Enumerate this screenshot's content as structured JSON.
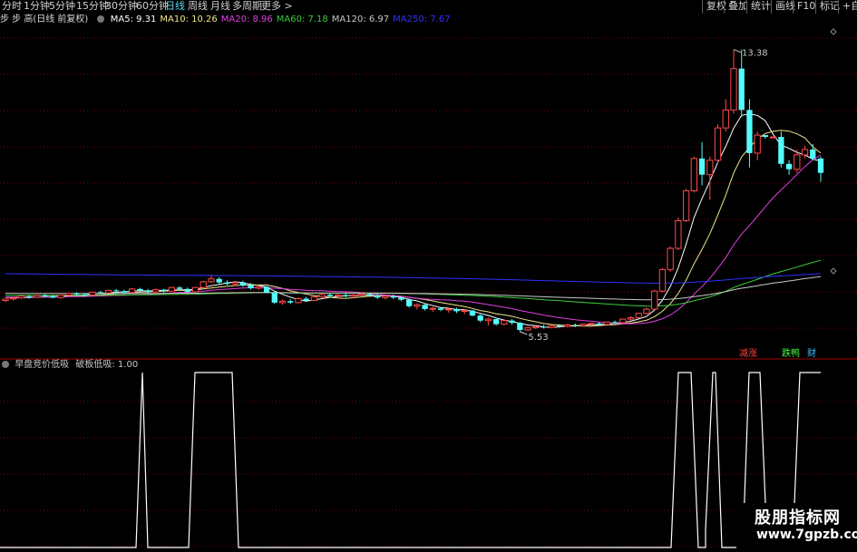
{
  "toolbar": {
    "periods": [
      "分时",
      "1分钟",
      "5分钟",
      "15分钟",
      "30分钟",
      "60分钟",
      "日线",
      "周线",
      "月线",
      "多周期",
      "更多 >"
    ],
    "active_period": "日线",
    "right_buttons": [
      "复权",
      "叠加",
      "统计",
      "画线",
      "F10",
      "标记",
      "+自选"
    ]
  },
  "main_header": {
    "title": "步 步 高(日线 前复权)",
    "ma": [
      {
        "label": "MA5: 9.31",
        "color": "#ffffff"
      },
      {
        "label": "MA10: 10.26",
        "color": "#f0e68c"
      },
      {
        "label": "MA20: 8.96",
        "color": "#e040e0"
      },
      {
        "label": "MA60: 7.18",
        "color": "#3ccd3c"
      },
      {
        "label": "MA120: 6.97",
        "color": "#c8c8c8"
      },
      {
        "label": "MA250: 7.67",
        "color": "#3030ff"
      }
    ]
  },
  "annotations": {
    "high": "13.38",
    "low": "5.53"
  },
  "signal_labels": [
    {
      "text": "减涨",
      "color": "#ff4040"
    },
    {
      "text": "跌鸭",
      "color": "#40ff40"
    },
    {
      "text": "财",
      "color": "#40c0ff"
    }
  ],
  "sub_header": {
    "title": "早盘竞价低吸",
    "indicator": "破板低吸: 1.00"
  },
  "watermark": {
    "title": "股朋指标网",
    "url": "www.7gpzb.com"
  },
  "colors": {
    "up": "#ff4a4a",
    "down": "#54fcfc",
    "bg": "#000000",
    "grid": "#7a0000"
  },
  "chart_data": {
    "type": "candlestick",
    "price_range": [
      5.53,
      13.38
    ],
    "candles": [
      [
        6.4,
        6.45,
        6.35,
        6.44
      ],
      [
        6.44,
        6.5,
        6.4,
        6.47
      ],
      [
        6.47,
        6.55,
        6.44,
        6.52
      ],
      [
        6.52,
        6.54,
        6.45,
        6.49
      ],
      [
        6.49,
        6.56,
        6.46,
        6.54
      ],
      [
        6.54,
        6.58,
        6.49,
        6.52
      ],
      [
        6.52,
        6.55,
        6.46,
        6.48
      ],
      [
        6.48,
        6.56,
        6.45,
        6.55
      ],
      [
        6.55,
        6.62,
        6.52,
        6.6
      ],
      [
        6.6,
        6.63,
        6.54,
        6.57
      ],
      [
        6.57,
        6.6,
        6.5,
        6.55
      ],
      [
        6.55,
        6.65,
        6.52,
        6.63
      ],
      [
        6.63,
        6.67,
        6.58,
        6.61
      ],
      [
        6.61,
        6.7,
        6.59,
        6.68
      ],
      [
        6.68,
        6.72,
        6.62,
        6.66
      ],
      [
        6.66,
        6.7,
        6.58,
        6.62
      ],
      [
        6.62,
        6.74,
        6.6,
        6.72
      ],
      [
        6.72,
        6.75,
        6.64,
        6.68
      ],
      [
        6.68,
        6.72,
        6.6,
        6.64
      ],
      [
        6.64,
        6.73,
        6.61,
        6.7
      ],
      [
        6.7,
        6.72,
        6.62,
        6.66
      ],
      [
        6.66,
        6.78,
        6.64,
        6.76
      ],
      [
        6.76,
        6.8,
        6.68,
        6.72
      ],
      [
        6.72,
        6.76,
        6.6,
        6.64
      ],
      [
        6.64,
        6.78,
        6.62,
        6.76
      ],
      [
        6.76,
        6.95,
        6.74,
        6.92
      ],
      [
        6.92,
        7.1,
        6.88,
        7.0
      ],
      [
        7.0,
        7.05,
        6.86,
        6.9
      ],
      [
        6.9,
        6.96,
        6.82,
        6.86
      ],
      [
        6.86,
        6.94,
        6.8,
        6.9
      ],
      [
        6.9,
        6.95,
        6.78,
        6.82
      ],
      [
        6.82,
        6.88,
        6.7,
        6.74
      ],
      [
        6.74,
        6.82,
        6.7,
        6.78
      ],
      [
        6.78,
        6.8,
        6.6,
        6.62
      ],
      [
        6.62,
        6.65,
        6.3,
        6.34
      ],
      [
        6.34,
        6.42,
        6.28,
        6.38
      ],
      [
        6.38,
        6.44,
        6.3,
        6.34
      ],
      [
        6.34,
        6.48,
        6.32,
        6.45
      ],
      [
        6.45,
        6.5,
        6.36,
        6.4
      ],
      [
        6.4,
        6.52,
        6.38,
        6.5
      ],
      [
        6.5,
        6.6,
        6.46,
        6.56
      ],
      [
        6.56,
        6.6,
        6.48,
        6.52
      ],
      [
        6.52,
        6.58,
        6.46,
        6.55
      ],
      [
        6.55,
        6.6,
        6.48,
        6.52
      ],
      [
        6.52,
        6.58,
        6.46,
        6.55
      ],
      [
        6.55,
        6.62,
        6.5,
        6.58
      ],
      [
        6.58,
        6.62,
        6.5,
        6.54
      ],
      [
        6.54,
        6.58,
        6.44,
        6.48
      ],
      [
        6.48,
        6.55,
        6.42,
        6.52
      ],
      [
        6.52,
        6.56,
        6.44,
        6.48
      ],
      [
        6.48,
        6.52,
        6.38,
        6.42
      ],
      [
        6.42,
        6.46,
        6.2,
        6.24
      ],
      [
        6.24,
        6.32,
        6.15,
        6.28
      ],
      [
        6.28,
        6.32,
        6.12,
        6.16
      ],
      [
        6.16,
        6.22,
        6.08,
        6.18
      ],
      [
        6.18,
        6.22,
        6.1,
        6.14
      ],
      [
        6.14,
        6.2,
        6.06,
        6.16
      ],
      [
        6.16,
        6.2,
        6.05,
        6.1
      ],
      [
        6.1,
        6.15,
        6.02,
        6.12
      ],
      [
        6.12,
        6.14,
        5.96,
        5.98
      ],
      [
        5.98,
        6.02,
        5.8,
        5.84
      ],
      [
        5.84,
        5.92,
        5.7,
        5.88
      ],
      [
        5.88,
        5.92,
        5.7,
        5.74
      ],
      [
        5.74,
        5.86,
        5.7,
        5.84
      ],
      [
        5.84,
        5.88,
        5.72,
        5.78
      ],
      [
        5.78,
        5.8,
        5.53,
        5.58
      ],
      [
        5.58,
        5.66,
        5.55,
        5.64
      ],
      [
        5.64,
        5.7,
        5.6,
        5.67
      ],
      [
        5.67,
        5.72,
        5.62,
        5.65
      ],
      [
        5.65,
        5.72,
        5.62,
        5.7
      ],
      [
        5.7,
        5.74,
        5.64,
        5.68
      ],
      [
        5.68,
        5.75,
        5.65,
        5.72
      ],
      [
        5.72,
        5.76,
        5.66,
        5.7
      ],
      [
        5.7,
        5.76,
        5.68,
        5.74
      ],
      [
        5.74,
        5.78,
        5.7,
        5.76
      ],
      [
        5.76,
        5.8,
        5.7,
        5.73
      ],
      [
        5.73,
        5.82,
        5.72,
        5.8
      ],
      [
        5.8,
        5.84,
        5.75,
        5.78
      ],
      [
        5.78,
        5.9,
        5.76,
        5.88
      ],
      [
        5.88,
        5.96,
        5.84,
        5.92
      ],
      [
        5.92,
        6.06,
        5.9,
        6.04
      ],
      [
        6.04,
        6.2,
        6.0,
        6.16
      ],
      [
        6.16,
        6.7,
        6.14,
        6.66
      ],
      [
        6.66,
        7.3,
        6.62,
        7.26
      ],
      [
        7.26,
        7.9,
        7.2,
        7.85
      ],
      [
        7.85,
        8.7,
        7.8,
        8.62
      ],
      [
        8.62,
        9.5,
        8.58,
        9.45
      ],
      [
        9.45,
        10.4,
        9.4,
        10.35
      ],
      [
        10.35,
        10.8,
        9.6,
        9.9
      ],
      [
        9.9,
        10.4,
        9.2,
        10.3
      ],
      [
        10.3,
        11.3,
        10.2,
        11.2
      ],
      [
        11.2,
        12.0,
        11.1,
        11.7
      ],
      [
        11.7,
        13.38,
        11.6,
        12.85
      ],
      [
        12.85,
        13.38,
        11.5,
        11.7
      ],
      [
        11.7,
        12.0,
        10.1,
        10.5
      ],
      [
        10.5,
        11.1,
        10.3,
        11.0
      ],
      [
        11.0,
        11.0,
        10.9,
        10.95
      ],
      [
        10.95,
        10.96,
        10.94,
        10.95
      ],
      [
        10.95,
        11.1,
        10.1,
        10.2
      ],
      [
        10.2,
        10.3,
        9.9,
        10.05
      ],
      [
        10.05,
        10.6,
        9.95,
        10.45
      ],
      [
        10.45,
        10.7,
        10.35,
        10.6
      ],
      [
        10.6,
        10.75,
        10.3,
        10.35
      ],
      [
        10.35,
        10.4,
        9.7,
        9.95
      ]
    ],
    "sub_indicator": {
      "name": "破板低吸",
      "range": [
        0,
        1
      ],
      "segments": [
        {
          "x": [
            150,
            156,
            162,
            209,
            215,
            221
          ],
          "y": [
            0,
            1,
            0,
            0,
            1,
            0
          ],
          "hold_top": [
            [
              156,
              156
            ],
            [
              215,
              256
            ]
          ]
        }
      ]
    }
  }
}
